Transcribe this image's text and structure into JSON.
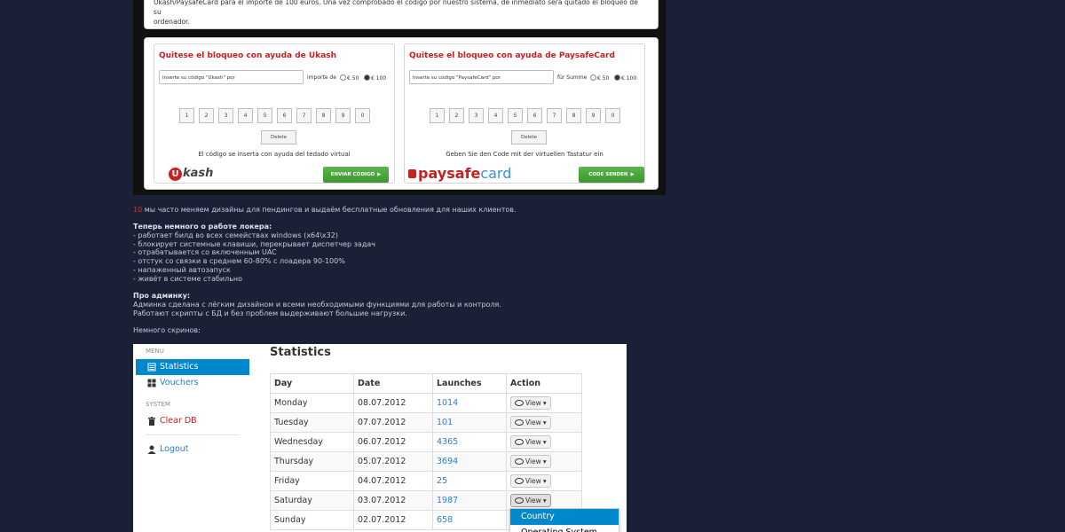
{
  "top": {
    "intro_line1": "Ukash/PaysafeCard para el importe de 100 euros. Una vez comprobado el código por nuestro sistema, de inmediato será quitado el bloqueo de su",
    "intro_line2": "ordenador."
  },
  "ukash": {
    "title": "Quitese el bloqueo con ayuda de Ukash",
    "input_value": "Inserte su código \"Ukash\" por",
    "amount_label": "importe de",
    "radio_50": "€ 50",
    "radio_100": "€ 100",
    "keys": [
      "1",
      "2",
      "3",
      "4",
      "5",
      "6",
      "7",
      "8",
      "9",
      "0"
    ],
    "delete_label": "Delete",
    "note": "El código se inserta con ayuda del tedado virtual",
    "send_label": "ENVIAR CÓDIGO",
    "logo_letter": "U",
    "logo_text": "kash"
  },
  "psc": {
    "title": "Quitese el bloqueo con ayuda de PaysafeCard",
    "input_value": "Inserte su código \"PaysafeCard\" por",
    "amount_label": "für Summe",
    "radio_50": "€ 50",
    "radio_100": "€ 100",
    "keys": [
      "1",
      "2",
      "3",
      "4",
      "5",
      "6",
      "7",
      "8",
      "9",
      "0"
    ],
    "delete_label": "Delete",
    "note": "Geben Sie den Code mit der virtuellen Tastatur ein",
    "send_label": "CODE SENDEN",
    "logo_a": "paysafe",
    "logo_b": "card"
  },
  "forum": {
    "mark": "10",
    "p1": " мы часто меняем дизайны для пендингов и выдаём бесплатные обновления для наших клиентов.",
    "h2": "Теперь немного о работе локера:",
    "l1": "- работает билд во всех семействах windows (x64\\x32)",
    "l2": "- блокирует системные клавиши, перекрывает диспетчер задач",
    "l3": "- отрабатывается со включенным UAC",
    "l4": "- отстук со связки в среднем 60-80% с лоадера 90-100%",
    "l5": "- напаженный автозапуск",
    "l6": "- живёт в системе стабильно",
    "h3": "Про админку:",
    "a1": "Админка сделана с лёгким дизайном и всеми необходимыми функциями для работы и контроля.",
    "a2": "Работают скрипты с БД и без проблем выдерживают большие нагрузки.",
    "screens": "Немного скринов:"
  },
  "admin": {
    "menu_head": "MENU",
    "statistics": "Statistics",
    "vouchers": "Vouchers",
    "system_head": "SYSTEM",
    "clear_db": "Clear DB",
    "logout": "Logout",
    "page_title": "Statistics",
    "columns": [
      "Day",
      "Date",
      "Launches",
      "Action"
    ],
    "rows": [
      {
        "day": "Monday",
        "date": "08.07.2012",
        "launches": "1014",
        "action": "View"
      },
      {
        "day": "Tuesday",
        "date": "07.07.2012",
        "launches": "101",
        "action": "View"
      },
      {
        "day": "Wednesday",
        "date": "06.07.2012",
        "launches": "4365",
        "action": "View"
      },
      {
        "day": "Thursday",
        "date": "05.07.2012",
        "launches": "3694",
        "action": "View"
      },
      {
        "day": "Friday",
        "date": "04.07.2012",
        "launches": "25",
        "action": "View"
      },
      {
        "day": "Saturday",
        "date": "03.07.2012",
        "launches": "1987",
        "action": "View"
      },
      {
        "day": "Sunday",
        "date": "02.07.2012",
        "launches": "658",
        "action": ""
      }
    ],
    "dropdown": [
      "Country",
      "Operating System"
    ],
    "colors": {
      "accent": "#0088cc",
      "danger": "#c62020",
      "link": "#2a7fd4"
    }
  }
}
